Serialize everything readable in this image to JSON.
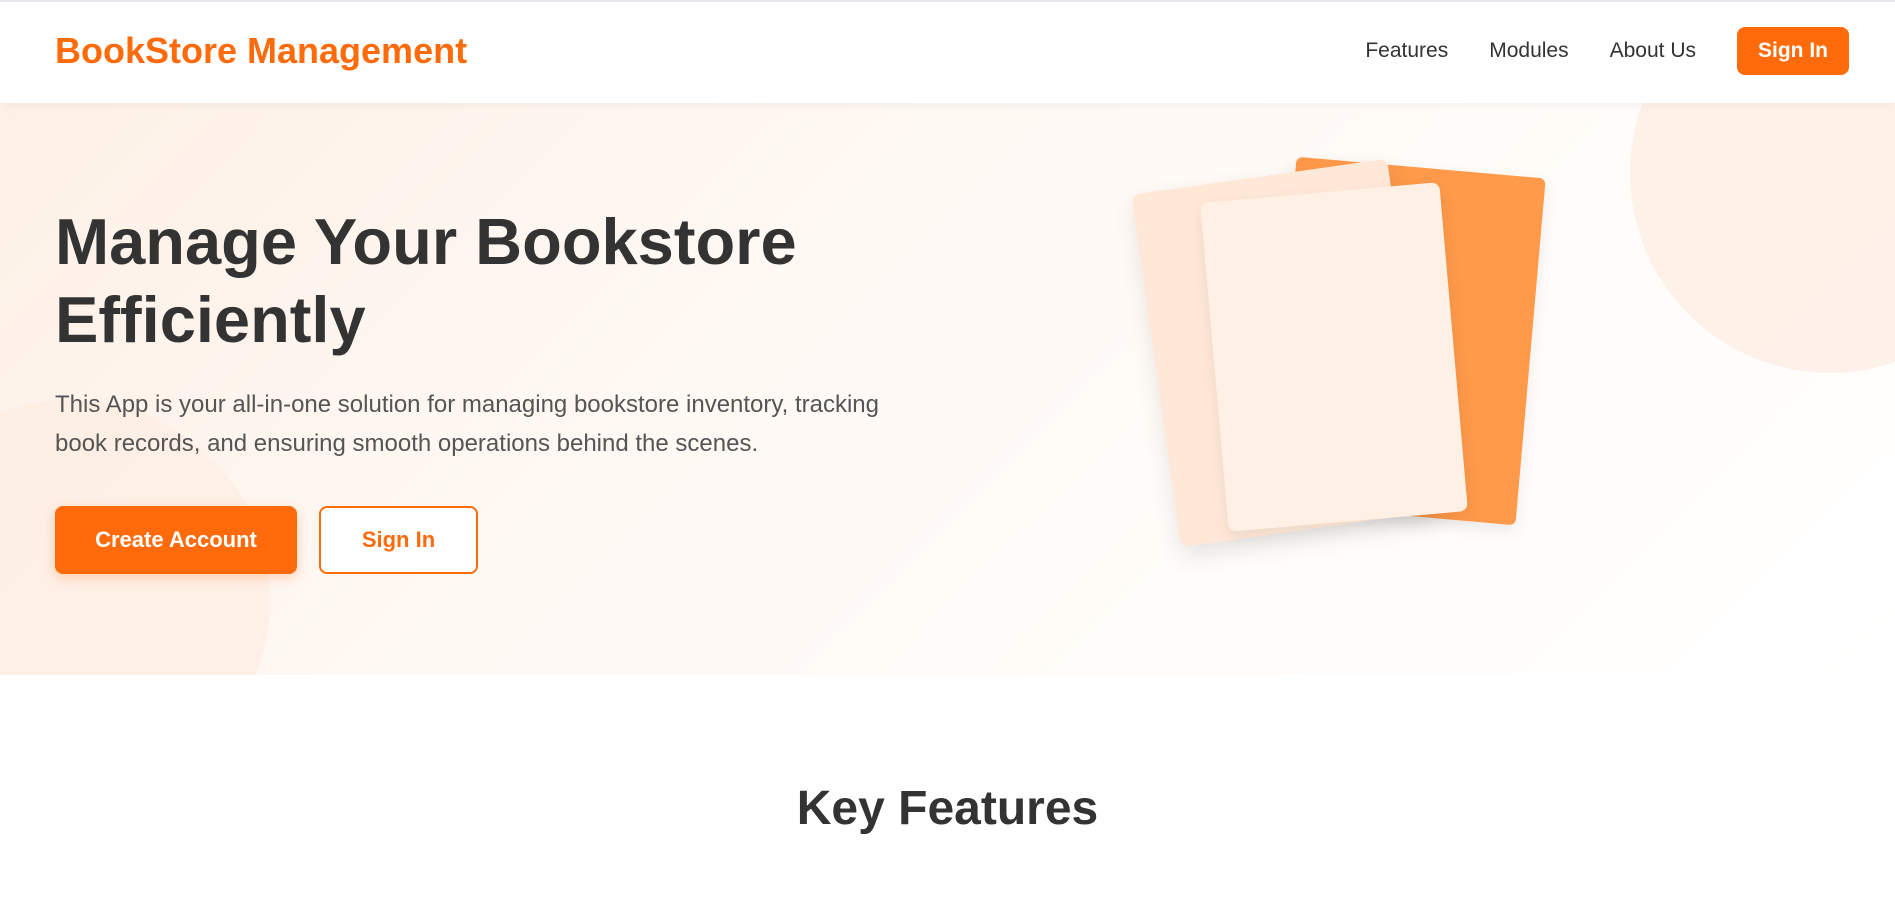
{
  "header": {
    "brand": "BookStore Management",
    "nav": {
      "features": "Features",
      "modules": "Modules",
      "about": "About Us"
    },
    "signin_label": "Sign In"
  },
  "hero": {
    "title": "Manage Your Bookstore Efficiently",
    "description": "This App is your all-in-one solution for managing bookstore inventory, tracking book records, and ensuring smooth operations behind the scenes.",
    "create_label": "Create Account",
    "signin_label": "Sign In"
  },
  "features": {
    "title": "Key Features"
  },
  "colors": {
    "accent": "#ff6b0a",
    "accent_light": "#ff9a4a",
    "text": "#333333",
    "hero_bg": "#fdf0e6"
  }
}
